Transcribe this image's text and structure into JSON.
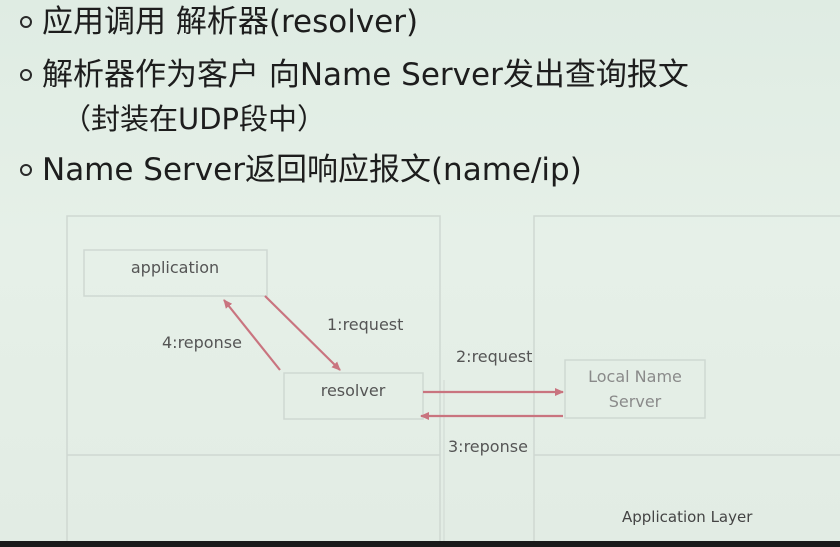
{
  "bullets": [
    {
      "text": "应用调用 解析器(resolver)"
    },
    {
      "text": "解析器作为客户 向Name Server发出查询报文",
      "continuation": "（封装在UDP段中）"
    },
    {
      "text": "Name Server返回响应报文(name/ip)"
    }
  ],
  "diagram": {
    "application": "application",
    "resolver": "resolver",
    "local_name_server_line1": "Local Name",
    "local_name_server_line2": "Server",
    "step1": "1:request",
    "step2": "2:request",
    "step3": "3:reponse",
    "step4": "4:reponse",
    "layer_label": "Application Layer",
    "arrow_color": "#c9747f",
    "box_color": "#cfd8d2"
  }
}
